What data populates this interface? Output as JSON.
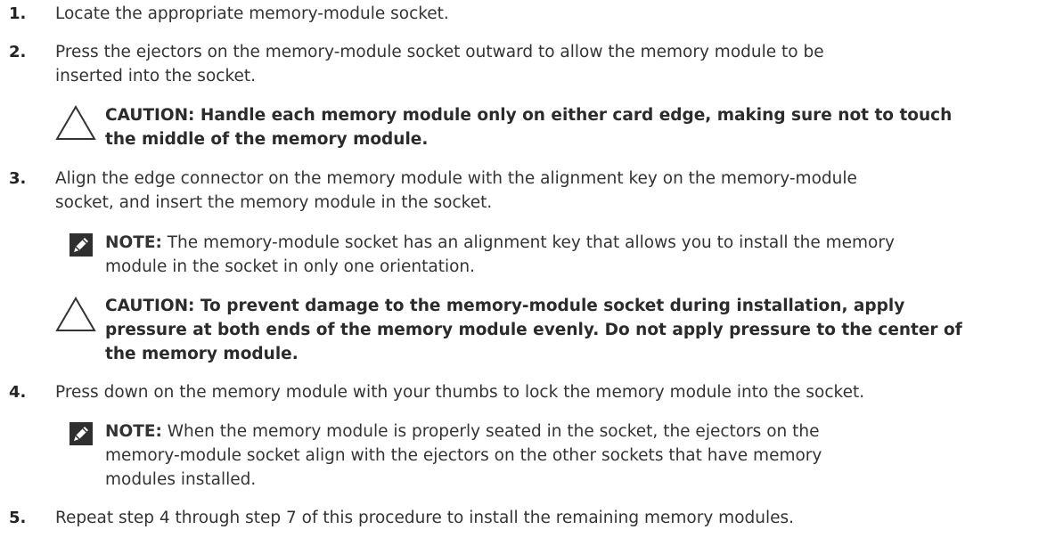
{
  "steps": [
    {
      "number": "1.",
      "lines": [
        "Locate the appropriate memory-module socket."
      ]
    },
    {
      "number": "2.",
      "lines": [
        "Press the ejectors on the memory-module socket outward to allow the memory module to be",
        "inserted into the socket."
      ]
    },
    {
      "number": "3.",
      "lines": [
        "Align the edge connector on the memory module with the alignment key on the memory-module",
        "socket, and insert the memory module in the socket."
      ]
    },
    {
      "number": "4.",
      "lines": [
        "Press down on the memory module with your thumbs to lock the memory module into the socket."
      ]
    },
    {
      "number": "5.",
      "lines": [
        "Repeat step 4 through step 7 of this procedure to install the remaining memory modules."
      ]
    }
  ],
  "cautions": [
    {
      "lines": [
        "CAUTION: Handle each memory module only on either card edge, making sure not to touch",
        "the middle of the memory module."
      ]
    },
    {
      "lines": [
        "CAUTION: To prevent damage to the memory-module socket during installation, apply",
        "pressure at both ends of the memory module evenly. Do not apply pressure to the center of",
        "the memory module."
      ]
    }
  ],
  "notes": [
    {
      "label": "NOTE:",
      "lines": [
        " The memory-module socket has an alignment key that allows you to install the memory",
        "module in the socket in only one orientation."
      ]
    },
    {
      "label": "NOTE:",
      "lines": [
        " When the memory module is properly seated in the socket, the ejectors on the",
        "memory-module socket align with the ejectors on the other sockets that have memory",
        "modules installed."
      ]
    }
  ],
  "icons": {
    "caution": "caution-triangle-icon",
    "note": "note-pencil-icon"
  }
}
